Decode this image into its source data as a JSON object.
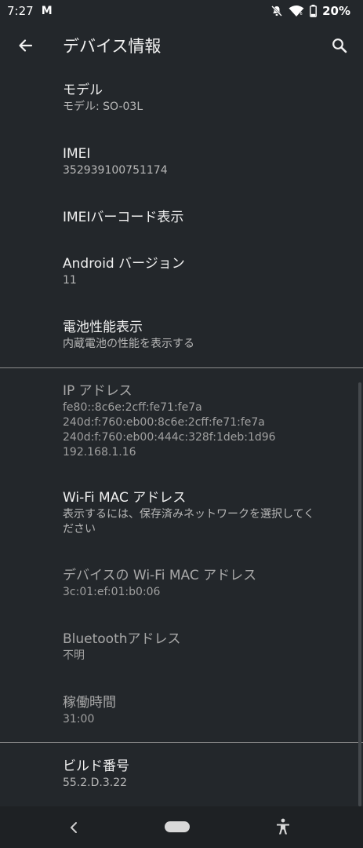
{
  "status": {
    "time": "7:27",
    "notification_icon": "M",
    "battery": "20%",
    "icons": [
      "gmail-icon",
      "mute-icon",
      "wifi-icon",
      "battery-icon"
    ]
  },
  "app_bar": {
    "title": "デバイス情報",
    "back_icon": "arrow-back-icon",
    "search_icon": "search-icon"
  },
  "items": [
    {
      "title": "モデル",
      "summary": "モデル: SO-03L"
    },
    {
      "title": "IMEI",
      "summary": "352939100751174"
    },
    {
      "title": "IMEIバーコード表示"
    },
    {
      "title": "Android バージョン",
      "summary": "11"
    },
    {
      "title": "電池性能表示",
      "summary": "内蔵電池の性能を表示する"
    },
    {
      "title": "IP アドレス",
      "summary": "fe80::8c6e:2cff:fe71:fe7a",
      "summary2": "240d:f:760:eb00:8c6e:2cff:fe71:fe7a",
      "summary3": "240d:f:760:eb00:444c:328f:1deb:1d96",
      "summary4": "192.168.1.16"
    },
    {
      "title": "Wi-Fi MAC アドレス",
      "summary": "表示するには、保存済みネットワークを選択してく",
      "summary2": "ださい"
    },
    {
      "title": "デバイスの Wi-Fi MAC アドレス",
      "summary": "3c:01:ef:01:b0:06"
    },
    {
      "title": "Bluetoothアドレス",
      "summary": "不明"
    },
    {
      "title": "稼働時間",
      "summary": "31:00"
    },
    {
      "title": "ビルド番号",
      "summary": "55.2.D.3.22"
    }
  ],
  "nav": {
    "back_icon": "nav-back-icon",
    "home_icon": "home-pill-icon",
    "accessibility_icon": "accessibility-icon"
  }
}
